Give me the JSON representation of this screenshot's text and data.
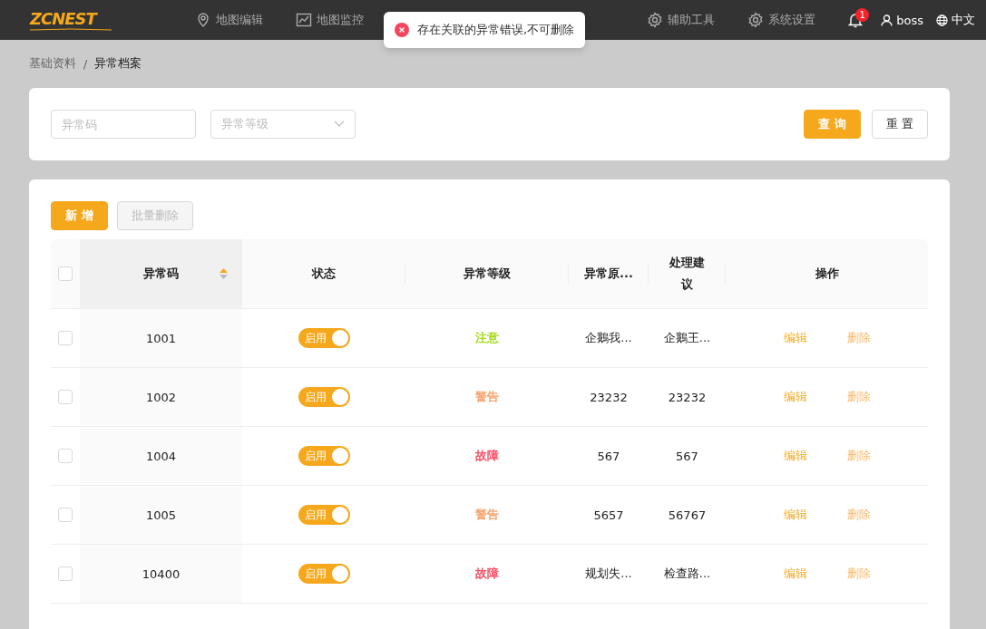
{
  "header": {
    "logo": "ZCNEST",
    "nav": [
      {
        "label": "地图编辑",
        "kind": "pin"
      },
      {
        "label": "地图监控",
        "kind": "chart"
      },
      {
        "label": "辅助工具",
        "kind": "gear"
      },
      {
        "label": "系统设置",
        "kind": "gear"
      }
    ],
    "notifications": "1",
    "user": "boss",
    "language": "中文"
  },
  "toast": {
    "message": "存在关联的异常错误,不可删除"
  },
  "breadcrumb": {
    "items": [
      "基础资料",
      "异常档案"
    ],
    "separator": "/"
  },
  "filters": {
    "code": {
      "placeholder": "异常码"
    },
    "level": {
      "placeholder": "异常等级"
    },
    "search_button": "查 询",
    "reset_button": "重 置"
  },
  "toolbar": {
    "add_button": "新 增",
    "batch_delete_button": "批量删除",
    "batch_delete_disabled": true
  },
  "table": {
    "all_checked": false,
    "columns": [
      {
        "label": "异常码",
        "sorted_ascending": true
      },
      {
        "label": "状态"
      },
      {
        "label": "异常等级"
      },
      {
        "label": "异常原..."
      },
      {
        "label": "处理建议"
      },
      {
        "label": "操作"
      }
    ],
    "rows": [
      {
        "checked": false,
        "code": "1001",
        "status": {
          "label": "启用",
          "on": true
        },
        "level": {
          "label": "注意",
          "color": "#a0d911"
        },
        "cause": "企鵝我...",
        "advice": "企鵝王...",
        "edit": "编辑",
        "delete": "删除"
      },
      {
        "checked": false,
        "code": "1002",
        "status": {
          "label": "启用",
          "on": true
        },
        "level": {
          "label": "警告",
          "color": "#f5a26b"
        },
        "cause": "23232",
        "advice": "23232",
        "edit": "编辑",
        "delete": "删除"
      },
      {
        "checked": false,
        "code": "1004",
        "status": {
          "label": "启用",
          "on": true
        },
        "level": {
          "label": "故障",
          "color": "#f5455c"
        },
        "cause": "567",
        "advice": "567",
        "edit": "编辑",
        "delete": "删除"
      },
      {
        "checked": false,
        "code": "1005",
        "status": {
          "label": "启用",
          "on": true
        },
        "level": {
          "label": "警告",
          "color": "#f5a26b"
        },
        "cause": "5657",
        "advice": "56767",
        "edit": "编辑",
        "delete": "删除"
      },
      {
        "checked": false,
        "code": "10400",
        "status": {
          "label": "启用",
          "on": true
        },
        "level": {
          "label": "故障",
          "color": "#f5455c"
        },
        "cause": "规划失...",
        "advice": "检查路...",
        "edit": "编辑",
        "delete": "删除"
      }
    ]
  }
}
